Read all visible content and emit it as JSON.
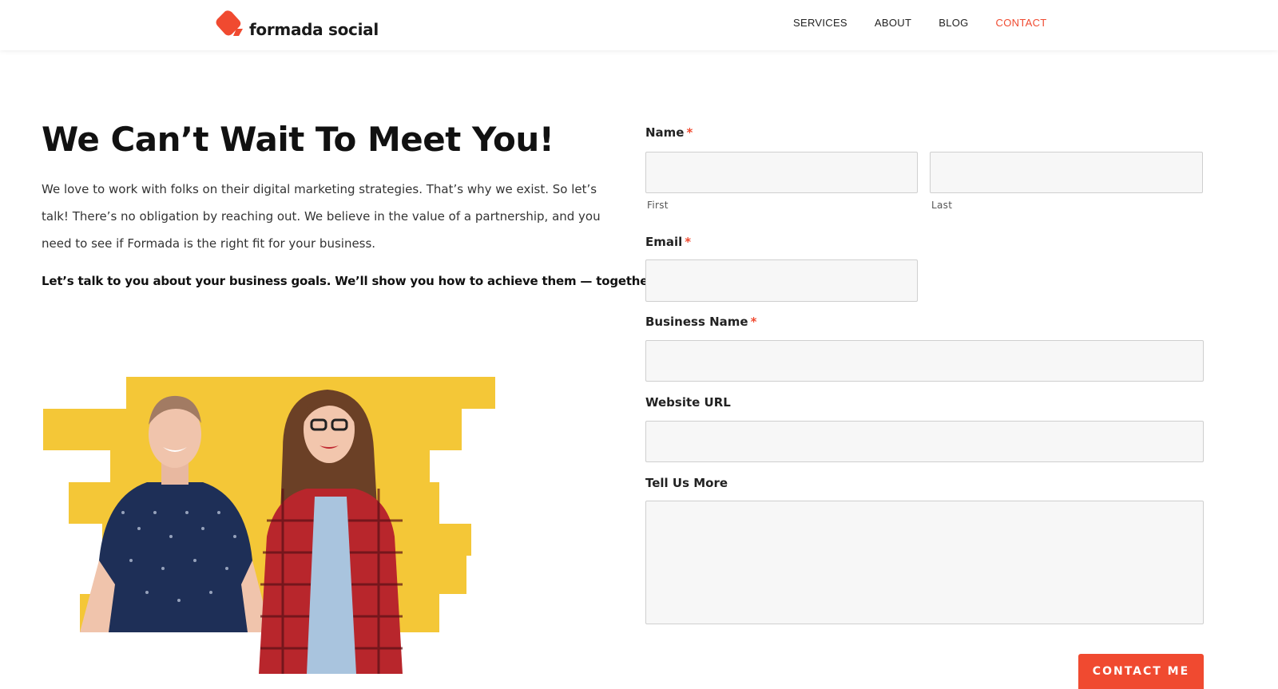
{
  "brand": {
    "name": "formada social",
    "accent": "#f04a30"
  },
  "nav": [
    {
      "label": "SERVICES",
      "active": false
    },
    {
      "label": "ABOUT",
      "active": false
    },
    {
      "label": "BLOG",
      "active": false
    },
    {
      "label": "CONTACT",
      "active": true
    }
  ],
  "hero": {
    "headline": "We Can’t Wait To Meet You!",
    "intro": "We love to work with folks on their digital marketing strategies. That’s why we exist. So let’s talk! There’s no obligation by reaching out. We believe in the value of a partnership, and you need to see if Formada is the right fit for your business.",
    "tagline": "Let’s talk to you about your business goals. We’ll show you how to achieve them — together."
  },
  "form": {
    "name_label": "Name",
    "first_sublabel": "First",
    "last_sublabel": "Last",
    "email_label": "Email",
    "business_label": "Business Name",
    "website_label": "Website URL",
    "message_label": "Tell Us More",
    "required_mark": "*",
    "submit_label": "CONTACT ME"
  }
}
